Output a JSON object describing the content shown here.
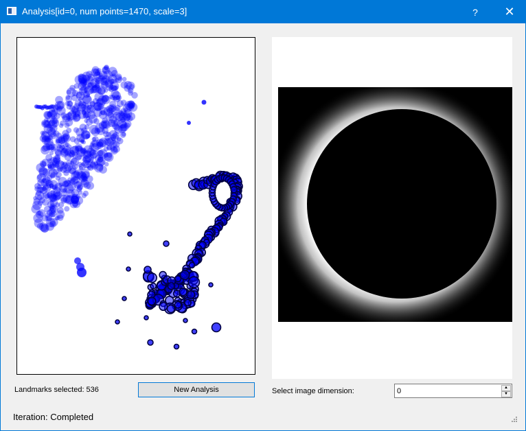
{
  "window": {
    "title": "Analysis[id=0, num points=1470, scale=3]",
    "help_label": "?",
    "close_label": "✕",
    "accent": "#0078d7"
  },
  "left": {
    "landmarks_text": "Landmarks selected: 536",
    "new_analysis_label": "New Analysis"
  },
  "right": {
    "dimension_label": "Select image dimension:",
    "dimension_value": "0"
  },
  "status": {
    "iteration_text": "Iteration: Completed"
  },
  "colors": {
    "point_fill": "#0000ff",
    "point_outline": "#000040",
    "image_background": "#000000",
    "ring_glow": "#ffffff"
  },
  "icons": {
    "app": "window-app-icon",
    "help": "help-icon",
    "close": "close-icon",
    "spin_up": "spin-up-arrow-icon",
    "spin_down": "spin-down-arrow-icon",
    "grip": "resize-grip-icon"
  }
}
